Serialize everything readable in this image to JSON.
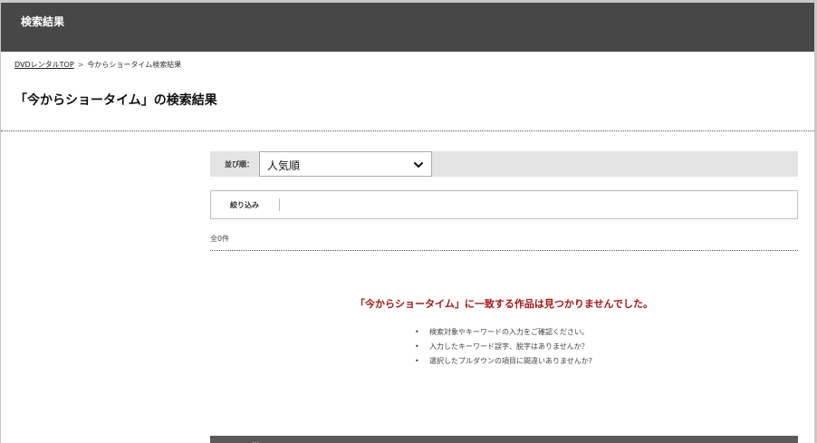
{
  "header": {
    "title": "検索結果"
  },
  "breadcrumb": {
    "home_link": "DVDレンタルTOP",
    "separator": ">",
    "current": "今からショータイム検索結果"
  },
  "page": {
    "title": "「今からショータイム」の検索結果"
  },
  "sort": {
    "label": "並び順：",
    "selected": "人気順"
  },
  "filter": {
    "label": "絞り込み"
  },
  "results": {
    "count_text": "全0件"
  },
  "empty": {
    "message": "「今からショータイム」に一致する作品は見つかりませんでした。",
    "tips": [
      "検索対象やキーワードの入力をご確認ください。",
      "入力したキーワード誤字、脱字はありませんか？",
      "選択したプルダウンの項目に間違いありませんか?"
    ]
  },
  "bottom": {
    "partial_text": "…"
  },
  "colors": {
    "header_bg": "#474747",
    "error_text": "#a31818",
    "sort_bar_bg": "#e4e4e4"
  }
}
